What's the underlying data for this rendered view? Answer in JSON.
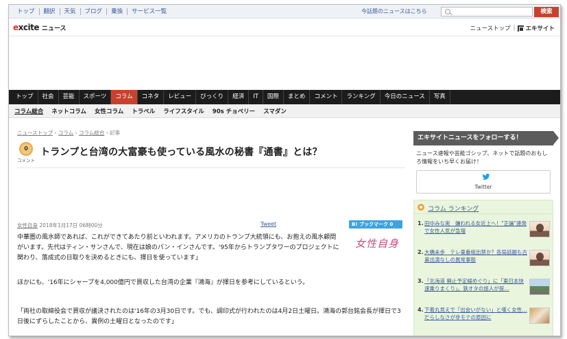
{
  "util": {
    "links": [
      "トップ",
      "翻訳",
      "天気",
      "ブログ",
      "乗換",
      "サービス一覧"
    ],
    "topic_link": "今話題のニュースはこちら",
    "search_placeholder": "",
    "search_button": "検索"
  },
  "brand": {
    "logo_prefix": "e",
    "logo_main": "xcite",
    "logo_suffix": "ニュース",
    "news_top": "ニューストップ",
    "excite_link": "エキサイト"
  },
  "mainnav": {
    "items": [
      "トップ",
      "社会",
      "芸能",
      "スポーツ",
      "コラム",
      "コネタ",
      "レビュー",
      "びっくり",
      "経済",
      "IT",
      "国際",
      "まとめ",
      "コメント",
      "ランキング",
      "今日のニュース",
      "写真"
    ],
    "active_index": 4
  },
  "subnav": {
    "items": [
      "コラム総合",
      "ネットコラム",
      "女性コラム",
      "トラベル",
      "ライフスタイル",
      "90s チョベリー",
      "スマダン"
    ]
  },
  "breadcrumb": {
    "items": [
      "ニューストップ",
      "コラム",
      "コラム総合"
    ],
    "current": "記事"
  },
  "article": {
    "comment_count": "0",
    "comment_label": "コメント",
    "title": "トランプと台湾の大富豪も使っている風水の秘書『通書』とは？",
    "source": "女性自身",
    "date": "2018年1月17日 06時00分",
    "tweet": "Tweet",
    "bookmark": "B! ブックマーク 0",
    "source_logo": "女性自身",
    "paragraphs": [
      "中華圏の風水師であれば、これができてあたり前といわれます。アメリカのトランプ大統領にも、お抱えの風水顧問がいます。先代はティン・サンさんで、現在は娘のパン・インさんです。'95年からトランプタワーのプロジェクトに関わり、落成式の日取りを決めるときにも、擇日を使っています」",
      "ほかにも、'16年にシャープを4,000億円で買収した台湾の企業『鴻海』が擇日を参考にしているという。",
      "「両社の取締役会で買収が議決されたのは'16年の3月30日です。でも、調印式が行われたのは4月2日土曜日。鴻海の郭台銘会長が擇日で3日後にずらしたことから、異例の土曜日となったのです」"
    ]
  },
  "sidebar": {
    "follow_title": "エキサイトニュースをフォローする！",
    "follow_desc": "ニュース速報や芸能ゴシップ、ネットで話題のおもしろ情報をいち早くお届け！",
    "twitter_label": "Twitter",
    "ranking_title": "コラム ランキング",
    "ranking": [
      {
        "num": "1.",
        "text": "田中みな実　嫌われる女近上へ！\"正論\"連発で女性人気が急増",
        "thumb": "person-icon"
      },
      {
        "num": "2.",
        "text": "大橋未歩　テレ東番組出禁か？各局話題も古巣出演なしの異常事態",
        "thumb": "person-icon"
      },
      {
        "num": "3.",
        "text": "「北海道 廃止予定線めぐり」に「東日本快速乗りまくり」。鉄オタの旅人が探…",
        "thumb": "train-icon"
      },
      {
        "num": "4.",
        "text": "下着丸見えで「出会いがない」と嘆く女性…だらしなさが非モテの原因に",
        "thumb": "gift-icon"
      }
    ]
  }
}
